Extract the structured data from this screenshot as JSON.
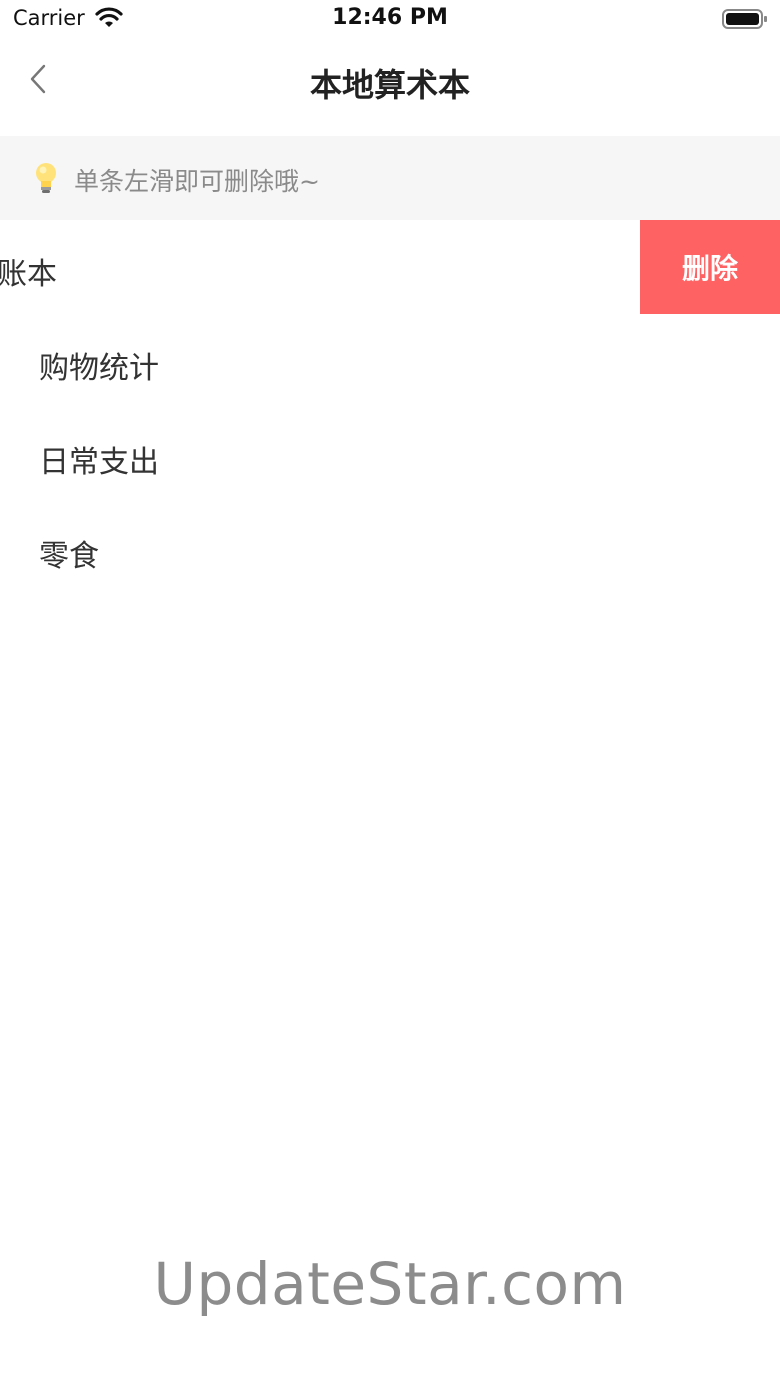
{
  "status_bar": {
    "carrier": "Carrier",
    "time": "12:46 PM",
    "wifi_icon": "wifi-icon",
    "battery_icon": "battery-icon"
  },
  "nav": {
    "title": "本地算术本",
    "back_icon": "chevron-left-icon"
  },
  "hint": {
    "icon": "lightbulb-icon",
    "text": "单条左滑即可删除哦~"
  },
  "list": {
    "items": [
      {
        "label": "账本",
        "swiped": true,
        "action_label": "删除"
      },
      {
        "label": "购物统计"
      },
      {
        "label": "日常支出"
      },
      {
        "label": "零食"
      }
    ]
  },
  "watermark": "UpdateStar.com",
  "colors": {
    "delete_bg": "#ff6262",
    "hint_bg": "#f6f6f6",
    "hint_text": "#8a8a8a"
  }
}
